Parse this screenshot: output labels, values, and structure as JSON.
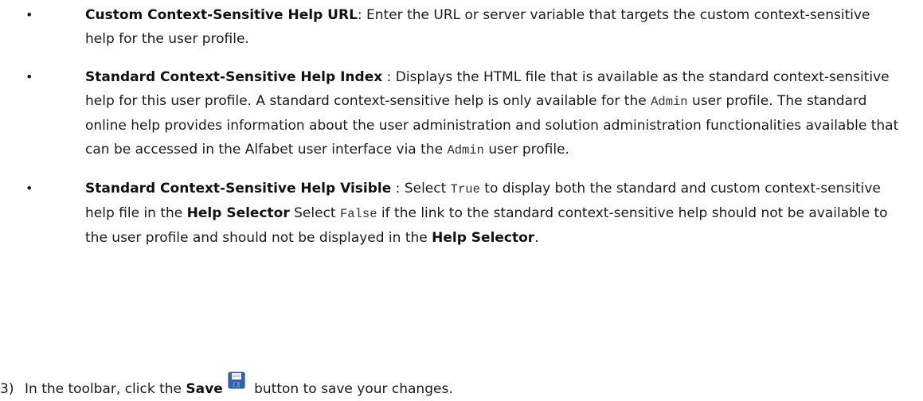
{
  "bullets": [
    {
      "title": "Custom Context-Sensitive Help URL",
      "sep": ": ",
      "text": "Enter the URL or server variable that targets the custom context-sensitive help for the user profile."
    },
    {
      "title": "Standard Context-Sensitive Help Index",
      "sep": " : ",
      "text_1": "Displays the HTML file that is available as the standard context-sensitive help for this user profile. A standard context-sensitive help is only available for the ",
      "code_1": "Admin",
      "text_2": " user profile. The standard online help provides information about the user administration and solution administration functionalities available that can be accessed in the Alfabet user interface via the ",
      "code_2": "Admin",
      "text_3": " user profile."
    },
    {
      "title": "Standard Context-Sensitive Help Visible",
      "sep": " : ",
      "text_1": "Select ",
      "code_1": "True",
      "text_2": " to display both the standard and custom context-sensitive help file in the ",
      "bold_1": "Help Selector",
      "text_3": " Select ",
      "code_2": "False",
      "text_4": " if the link to the standard context-sensitive help should not be available to the user profile and should not be displayed in the ",
      "bold_2": "Help Selector",
      "text_5": "."
    }
  ],
  "step": {
    "number": "3)",
    "text_before": "In the toolbar, click the ",
    "button_name": "Save",
    "icon": "floppy-disk-save-icon",
    "text_after": " button to save your changes."
  },
  "bullet_glyph": "•",
  "colors": {
    "text": "#1a1a1a",
    "code": "#333333",
    "icon_blue": "#2f62b8"
  }
}
